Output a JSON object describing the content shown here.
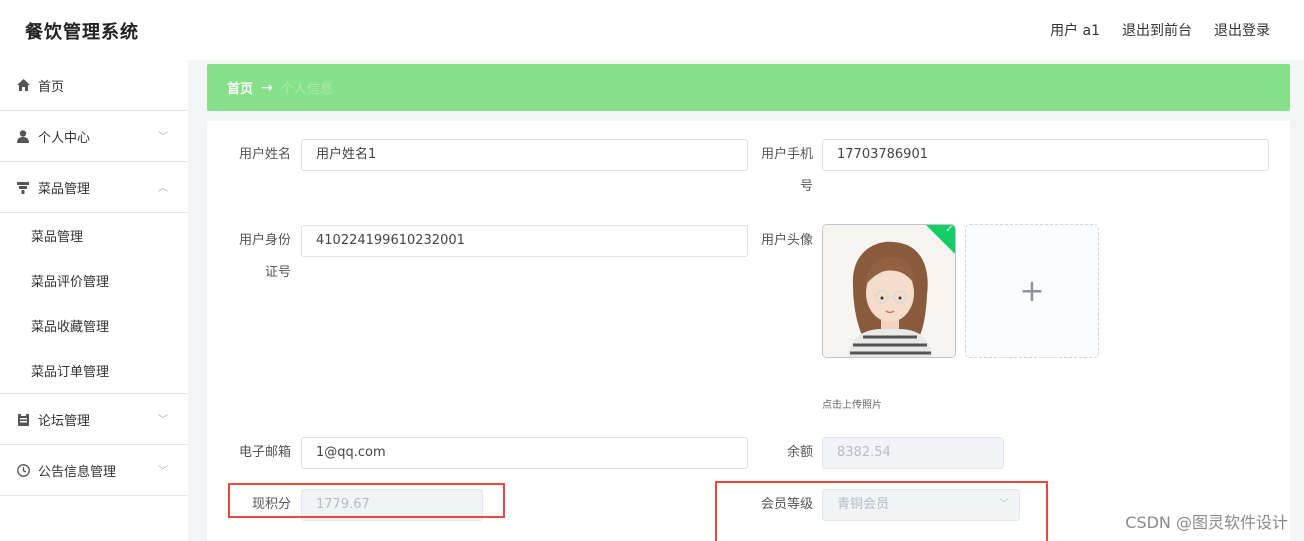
{
  "app": {
    "title": "餐饮管理系统"
  },
  "header": {
    "user_label": "用户 a1",
    "back_to_front": "退出到前台",
    "logout": "退出登录"
  },
  "sidebar": {
    "items": [
      {
        "label": "首页",
        "icon": "home-icon"
      },
      {
        "label": "个人中心",
        "icon": "user-icon",
        "expanded": false
      },
      {
        "label": "菜品管理",
        "icon": "dish-icon",
        "expanded": true
      },
      {
        "label": "论坛管理",
        "icon": "forum-icon",
        "expanded": false
      },
      {
        "label": "公告信息管理",
        "icon": "clock-icon",
        "expanded": false
      }
    ],
    "dish_submenu": [
      "菜品管理",
      "菜品评价管理",
      "菜品收藏管理",
      "菜品订单管理"
    ]
  },
  "breadcrumb": {
    "home": "首页",
    "arrow": "→",
    "current": "个人信息"
  },
  "form": {
    "name_label": "用户姓名",
    "name_value": "用户姓名1",
    "phone_label_1": "用户手机",
    "phone_label_2": "号",
    "phone_value": "17703786901",
    "id_label_1": "用户身份",
    "id_label_2": "证号",
    "id_value": "410224199610232001",
    "avatar_label": "用户头像",
    "upload_plus": "+",
    "upload_tip": "点击上传照片",
    "email_label": "电子邮箱",
    "email_value": "1@qq.com",
    "balance_label": "余额",
    "balance_value": "8382.54",
    "points_label": "现积分",
    "points_value": "1779.67",
    "level_label": "会员等级",
    "level_value": "青铜会员"
  },
  "watermark": "CSDN @图灵软件设计",
  "colors": {
    "accent_green": "#86e08a",
    "highlight_red": "#e8483d",
    "success_green": "#13ce66"
  }
}
